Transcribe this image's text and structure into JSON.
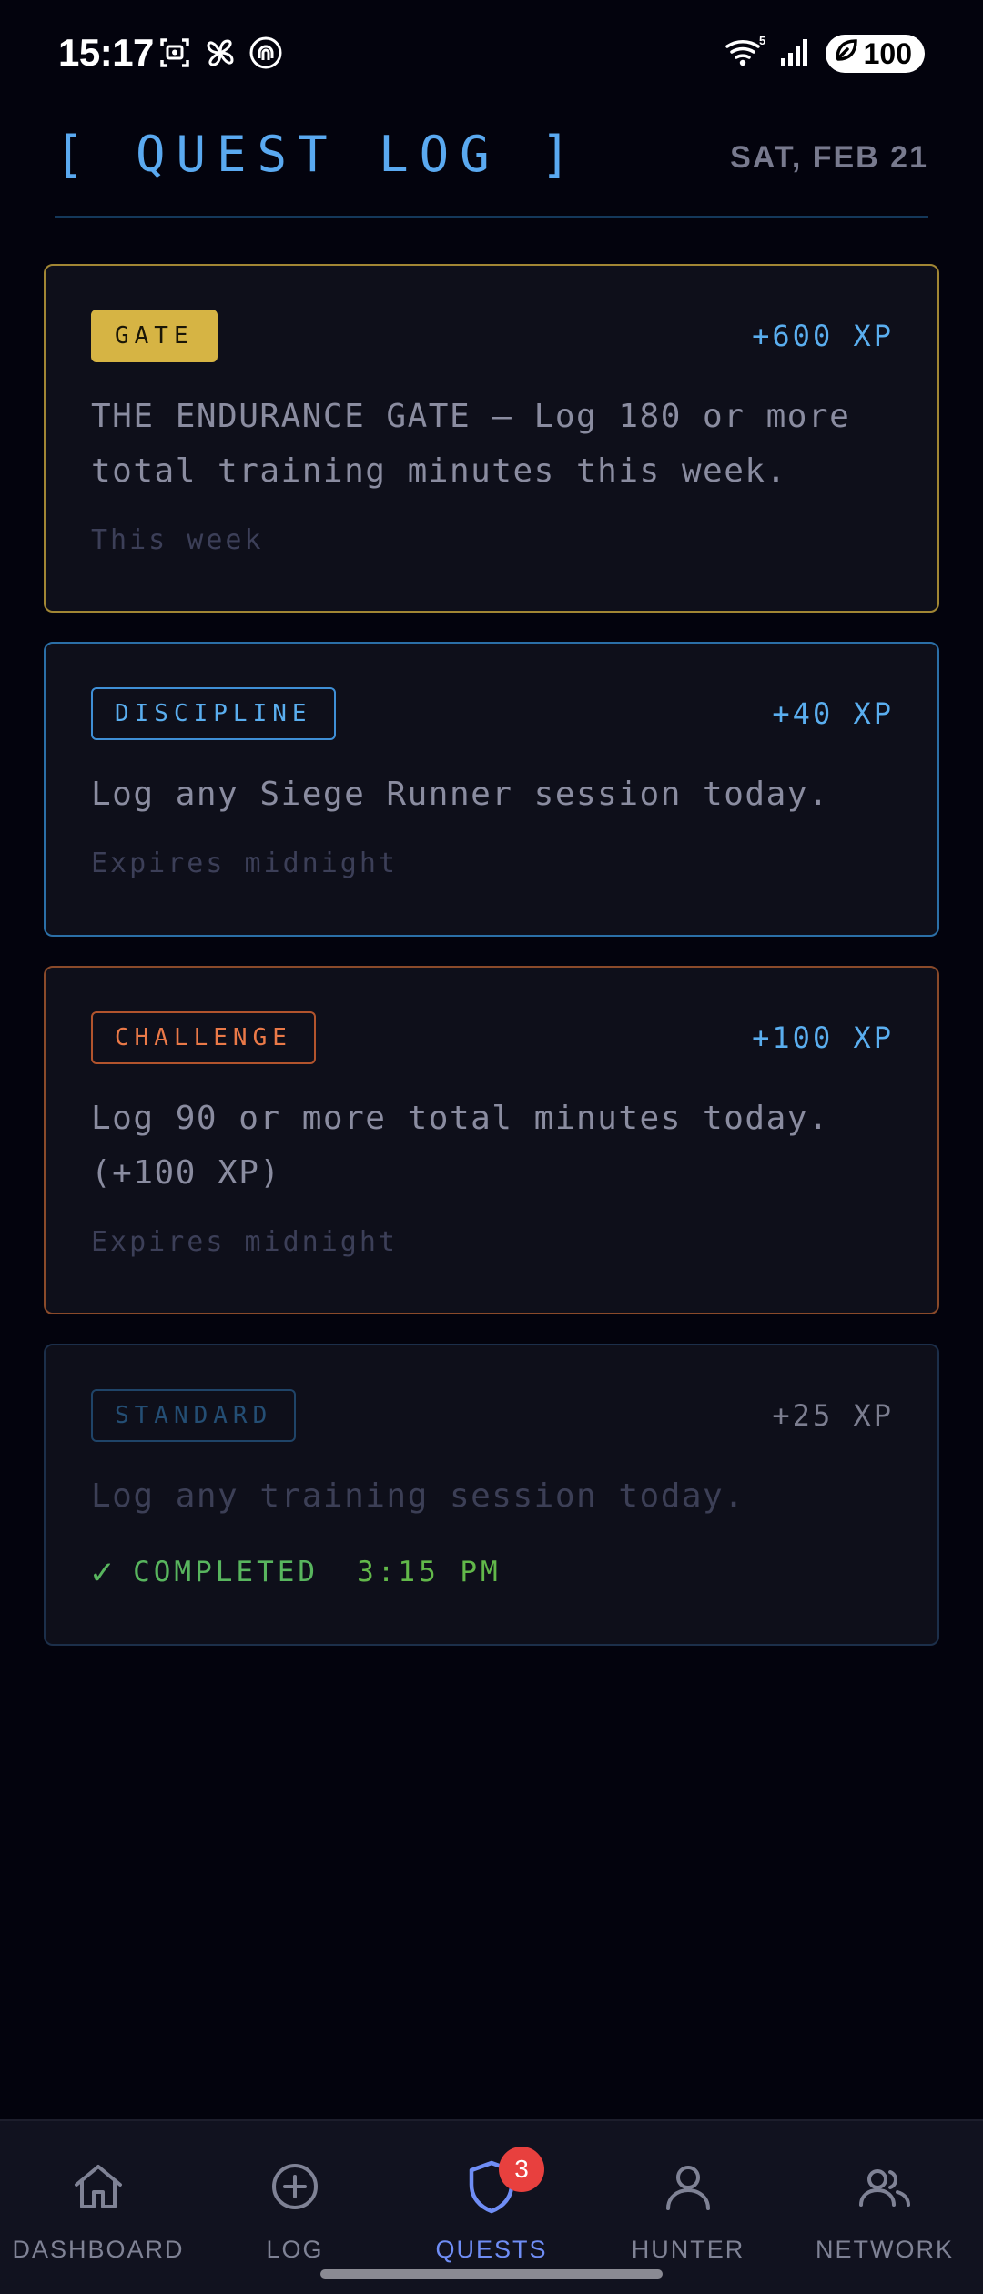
{
  "status_bar": {
    "time": "15:17",
    "wifi_label": "5",
    "battery": "100"
  },
  "header": {
    "title": "[ QUEST LOG ]",
    "date": "SAT, FEB 21"
  },
  "quests": [
    {
      "badge": "GATE",
      "xp": "+600 XP",
      "description": "THE ENDURANCE GATE — Log 180 or more total training minutes this week.",
      "meta": "This week"
    },
    {
      "badge": "DISCIPLINE",
      "xp": "+40 XP",
      "description": "Log any Siege Runner session today.",
      "meta": "Expires midnight"
    },
    {
      "badge": "CHALLENGE",
      "xp": "+100 XP",
      "description": "Log 90 or more total minutes today. (+100 XP)",
      "meta": "Expires midnight"
    },
    {
      "badge": "STANDARD",
      "xp": "+25 XP",
      "description": "Log any training session today.",
      "completed_label": "COMPLETED",
      "completed_time": "3:15 PM",
      "check_glyph": "✓"
    }
  ],
  "nav": {
    "items": [
      {
        "label": "DASHBOARD",
        "icon": "home-icon"
      },
      {
        "label": "LOG",
        "icon": "plus-circle-icon"
      },
      {
        "label": "QUESTS",
        "icon": "shield-icon",
        "badge": "3",
        "active": true
      },
      {
        "label": "HUNTER",
        "icon": "user-icon"
      },
      {
        "label": "NETWORK",
        "icon": "users-icon"
      }
    ]
  },
  "colors": {
    "background": "#03030d",
    "accent_blue": "#5aaeef",
    "gate_gold": "#d6b444",
    "challenge_orange": "#ea7948",
    "completed_green": "#58b55e",
    "nav_active": "#6f8df5",
    "badge_red": "#e8403e"
  }
}
